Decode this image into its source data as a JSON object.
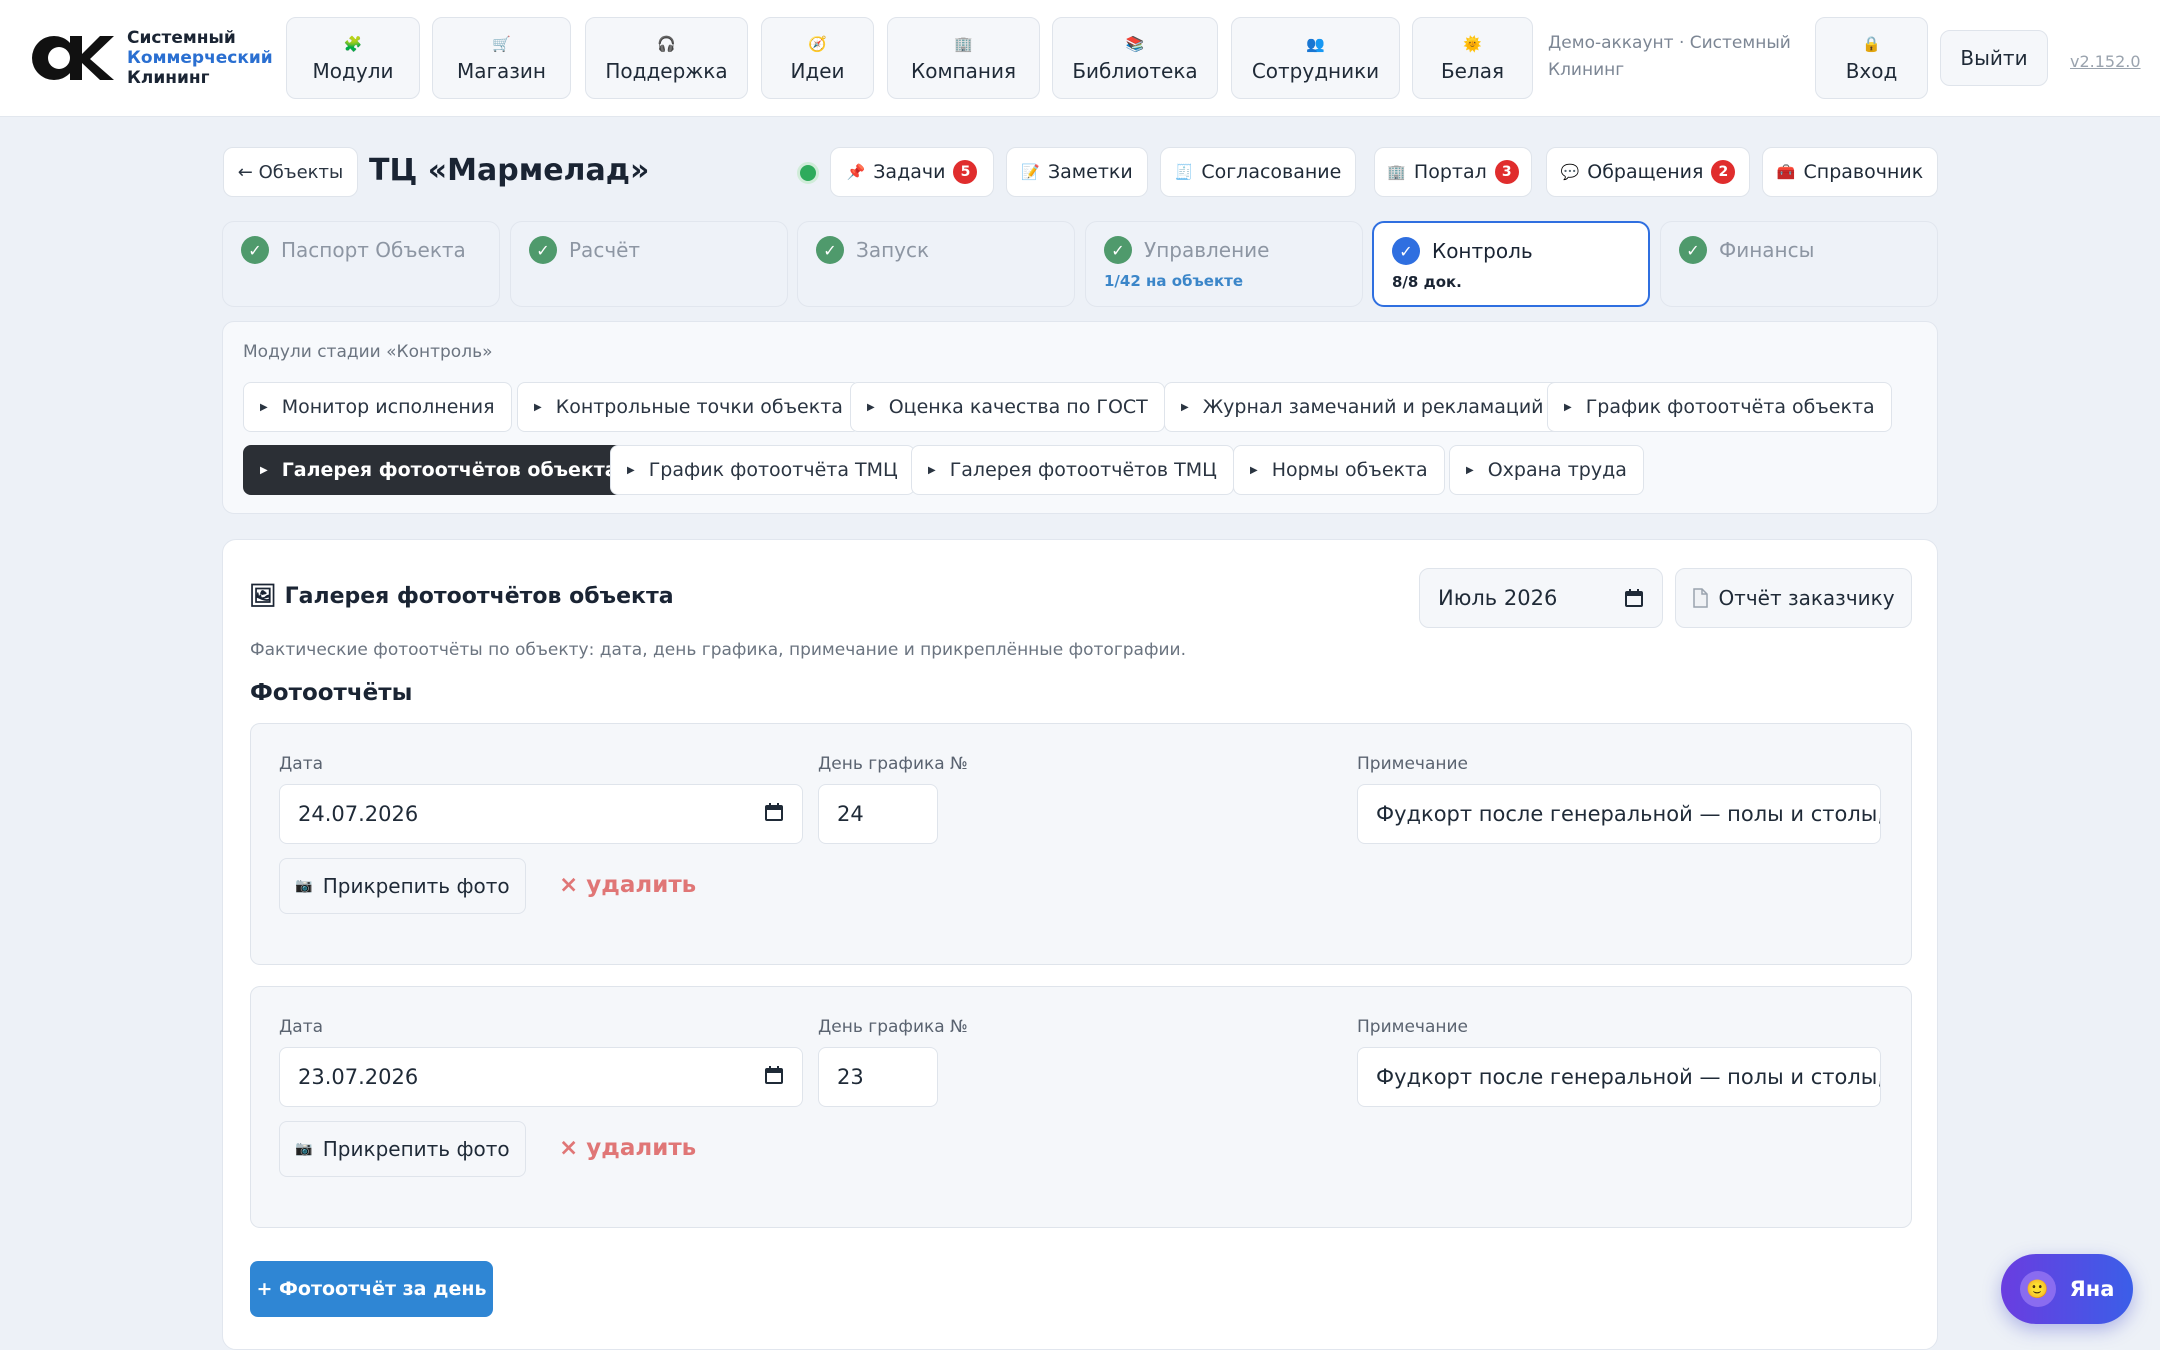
{
  "brand": {
    "line1": "Системный",
    "line2": "Коммерческий",
    "line3": "Клининг"
  },
  "nav": [
    {
      "icon": "puzzle-icon",
      "glyph": "🧩",
      "label": "Модули"
    },
    {
      "icon": "cart-icon",
      "glyph": "🛒",
      "label": "Магазин"
    },
    {
      "icon": "headphones-icon",
      "glyph": "🎧",
      "label": "Поддержка"
    },
    {
      "icon": "compass-icon",
      "glyph": "🧭",
      "label": "Идеи"
    },
    {
      "icon": "building-icon",
      "glyph": "🏢",
      "label": "Компания"
    },
    {
      "icon": "books-icon",
      "glyph": "📚",
      "label": "Библиотека"
    },
    {
      "icon": "people-icon",
      "glyph": "👥",
      "label": "Сотрудники"
    },
    {
      "icon": "sun-icon",
      "glyph": "🌞",
      "label": "Белая"
    }
  ],
  "account": {
    "text": "Демо-аккаунт · Системный Клининг"
  },
  "login": {
    "glyph": "🔒",
    "label": "Вход"
  },
  "logout": {
    "label": "Выйти"
  },
  "version": "v2.152.0",
  "object": {
    "back_label": "← Объекты",
    "title": "ТЦ «Мармелад»",
    "status_color": "#2eab5c"
  },
  "object_tabs": [
    {
      "icon": "pin-icon",
      "glyph": "📌",
      "label": "Задачи",
      "badge": "5"
    },
    {
      "icon": "memo-icon",
      "glyph": "📝",
      "label": "Заметки",
      "badge": ""
    },
    {
      "icon": "stamp-icon",
      "glyph": "🧾",
      "label": "Согласование",
      "badge": ""
    },
    {
      "icon": "portal-icon",
      "glyph": "🏢",
      "label": "Портал",
      "badge": "3"
    },
    {
      "icon": "speech-icon",
      "glyph": "💬",
      "label": "Обращения",
      "badge": "2"
    },
    {
      "icon": "toolbox-icon",
      "glyph": "🧰",
      "label": "Справочник",
      "badge": ""
    }
  ],
  "stages": [
    {
      "label": "Паспорт Объекта",
      "sub": ""
    },
    {
      "label": "Расчёт",
      "sub": ""
    },
    {
      "label": "Запуск",
      "sub": ""
    },
    {
      "label": "Управление",
      "sub": "1/42 на объекте"
    },
    {
      "label": "Контроль",
      "sub": "8/8 док."
    },
    {
      "label": "Финансы",
      "sub": ""
    }
  ],
  "modules": {
    "caption": "Модули стадии «Контроль»",
    "items": [
      "Монитор исполнения",
      "Контрольные точки объекта",
      "Оценка качества по ГОСТ",
      "Журнал замечаний и рекламаций",
      "График фотоотчёта объекта",
      "Галерея фотоотчётов объекта",
      "График фотоотчёта ТМЦ",
      "Галерея фотоотчётов ТМЦ",
      "Нормы объекта",
      "Охрана труда"
    ],
    "active_index": 5
  },
  "gallery": {
    "icon": "frame-icon",
    "title": "🖼 Галерея фотоотчётов объекта",
    "month": "Июль 2026",
    "report_label": "Отчёт заказчику",
    "description": "Фактические фотоотчёты по объекту: дата, день графика, примечание и прикреплённые фотографии.",
    "section": "Фотоотчёты",
    "labels": {
      "date": "Дата",
      "day": "День графика №",
      "note": "Примечание"
    },
    "attach_label": "Прикрепить фото",
    "delete_label": "× удалить",
    "add_label": "+ Фотоотчёт за день",
    "entries": [
      {
        "date": "24.07.2026",
        "day": "24",
        "note": "Фудкорт после генеральной — полы и столы, фото"
      },
      {
        "date": "23.07.2026",
        "day": "23",
        "note": "Фудкорт после генеральной — полы и столы, фото"
      }
    ]
  },
  "assistant": {
    "label": "Яна"
  }
}
